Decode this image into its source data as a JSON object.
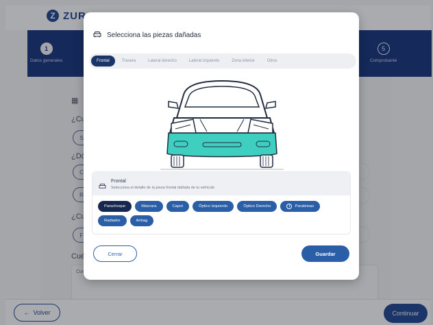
{
  "background": {
    "logo_mark": "Z",
    "logo_text": "ZUR",
    "steps": [
      {
        "number": "1",
        "label": "Datos generales"
      },
      {
        "number": "5",
        "label": "Comprobante"
      }
    ],
    "question_1": "¿Cu",
    "question_2": "¿Dó",
    "question_3": "¿Cu",
    "question_4": "Cué",
    "pill_s": "S",
    "pill_c": "C",
    "pill_r": "R",
    "pill_f": "F",
    "textarea_hint": "Cué",
    "back_label": "Volver",
    "continue_label": "Continuar"
  },
  "modal": {
    "title": "Selecciona las piezas dañadas",
    "tabs": [
      "Frontal",
      "Trasera",
      "Lateral derecho",
      "Lateral izquierdo",
      "Zona interior",
      "Otros"
    ],
    "active_tab": "Frontal",
    "section": {
      "title": "Frontal",
      "subtitle": "Selecciona el detalle de la pieza frontal dañada de tu vehículo"
    },
    "parts": [
      {
        "label": "Parachoque",
        "selected": true
      },
      {
        "label": "Máscara",
        "selected": false
      },
      {
        "label": "Capot",
        "selected": false
      },
      {
        "label": "Óptico Izquierdo",
        "selected": false
      },
      {
        "label": "Óptico Derecho",
        "selected": false
      },
      {
        "label": "Parabrisas",
        "selected": false
      },
      {
        "label": "Radiador",
        "selected": false
      },
      {
        "label": "Airbag",
        "selected": false
      }
    ],
    "close_label": "Cerrar",
    "save_label": "Guardar"
  },
  "colors": {
    "brand_navy": "#1c3568",
    "button_blue": "#2a5fa8",
    "highlight_teal": "#3ecfc0"
  }
}
